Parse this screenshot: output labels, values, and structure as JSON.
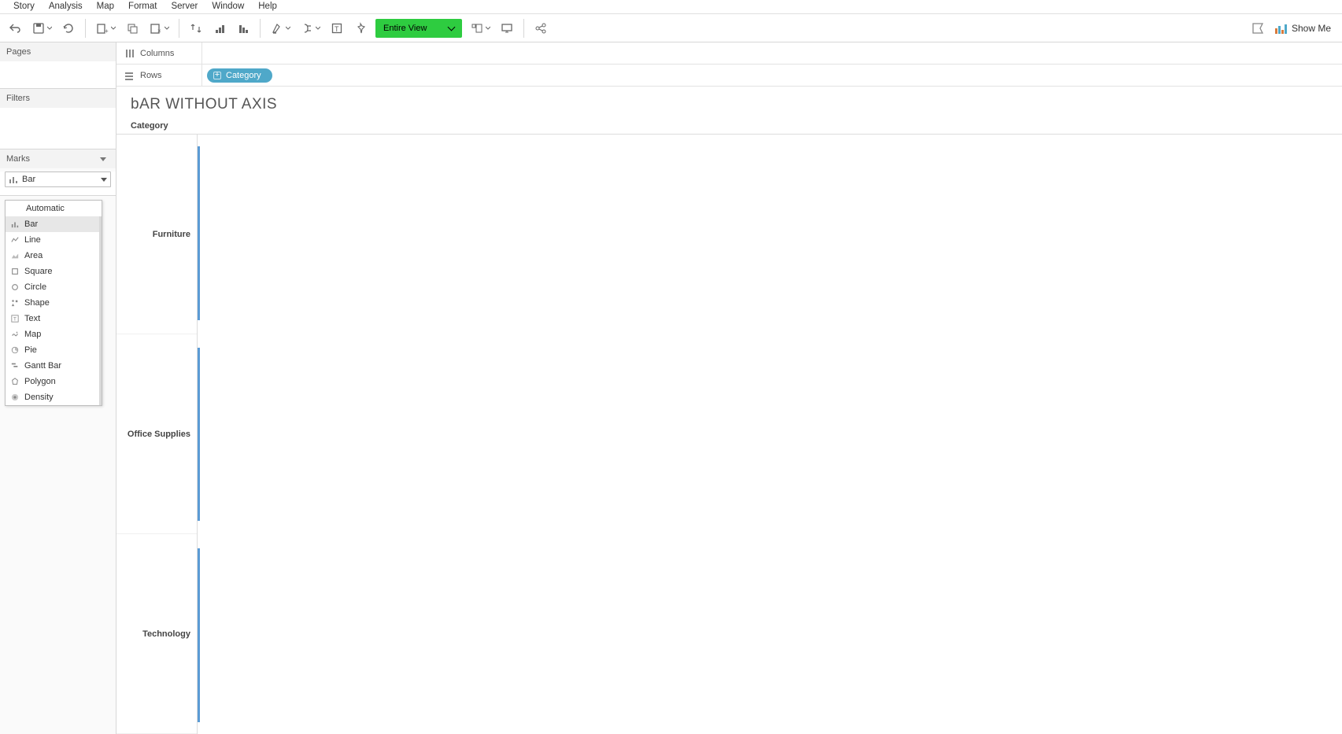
{
  "menubar": [
    "Story",
    "Analysis",
    "Map",
    "Format",
    "Server",
    "Window",
    "Help"
  ],
  "toolbar": {
    "fit_label": "Entire View",
    "showme_label": "Show Me"
  },
  "side": {
    "pages_label": "Pages",
    "filters_label": "Filters",
    "marks_label": "Marks",
    "mark_selected": "Bar",
    "mark_options": [
      "Automatic",
      "Bar",
      "Line",
      "Area",
      "Square",
      "Circle",
      "Shape",
      "Text",
      "Map",
      "Pie",
      "Gantt Bar",
      "Polygon",
      "Density"
    ]
  },
  "shelves": {
    "columns_label": "Columns",
    "rows_label": "Rows",
    "rows_pill": "Category"
  },
  "viz": {
    "title": "bAR WITHOUT AXIS",
    "row_header": "Category",
    "categories": [
      "Furniture",
      "Office Supplies",
      "Technology"
    ]
  },
  "chart_data": {
    "type": "bar",
    "orientation": "horizontal",
    "categories": [
      "Furniture",
      "Office Supplies",
      "Technology"
    ],
    "values": [
      1,
      1,
      1
    ],
    "note": "No measure on Columns — default Abc/blank bars shown as thin marks; axis hidden",
    "title": "bAR WITHOUT AXIS",
    "xlabel": "",
    "ylabel": "Category"
  }
}
